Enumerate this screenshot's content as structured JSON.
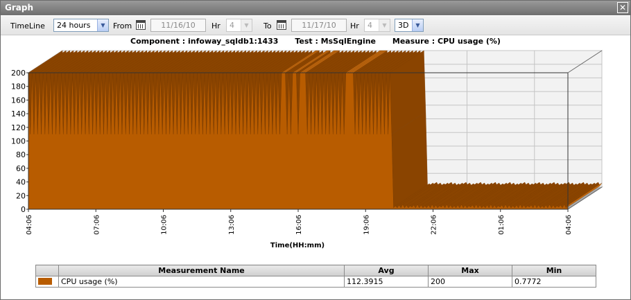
{
  "window": {
    "title": "Graph",
    "close_label": "✕"
  },
  "toolbar": {
    "timeline_label": "TimeLine",
    "timeline_value": "24 hours",
    "from_label": "From",
    "from_date": "11/16/10",
    "from_hr_label": "Hr",
    "from_hr_value": "4",
    "to_label": "To",
    "to_date": "11/17/10",
    "to_hr_label": "Hr",
    "to_hr_value": "4",
    "view_mode": "3D"
  },
  "header": {
    "component": "Component : infoway_sqldb1:1433",
    "test": "Test : MsSqlEngine",
    "measure": "Measure : CPU usage  (%)"
  },
  "chart_data": {
    "type": "area",
    "title": "",
    "xlabel": "Time(HH:mm)",
    "ylabel": "",
    "ylim": [
      0,
      200
    ],
    "yticks": [
      "0",
      "20",
      "40",
      "60",
      "80",
      "100",
      "120",
      "140",
      "160",
      "180",
      "200"
    ],
    "xticks": [
      "04:06",
      "07:06",
      "10:06",
      "13:06",
      "16:06",
      "19:06",
      "22:06",
      "01:06",
      "04:06"
    ],
    "series": [
      {
        "name": "CPU usage (%)",
        "color": "#b85c00",
        "values": [
          200,
          110,
          200,
          110,
          200,
          110,
          200,
          110,
          200,
          110,
          200,
          110,
          200,
          110,
          200,
          110,
          200,
          110,
          200,
          110,
          200,
          110,
          200,
          110,
          200,
          110,
          200,
          110,
          200,
          110,
          200,
          110,
          200,
          110,
          200,
          110,
          200,
          110,
          200,
          110,
          200,
          110,
          200,
          110,
          200,
          110,
          200,
          110,
          200,
          110,
          200,
          110,
          200,
          110,
          200,
          110,
          200,
          110,
          200,
          110,
          200,
          110,
          200,
          110,
          200,
          110,
          200,
          110,
          200,
          110,
          200,
          110,
          200,
          110,
          200,
          110,
          200,
          110,
          200,
          110,
          200,
          110,
          200,
          110,
          200,
          110,
          200,
          110,
          200,
          110,
          200,
          110,
          200,
          110,
          200,
          110,
          200,
          110,
          200,
          110,
          200,
          110,
          200,
          110,
          200,
          110,
          200,
          110,
          200,
          110,
          200,
          110,
          200,
          110,
          200,
          110,
          200,
          110,
          200,
          110,
          200,
          110,
          200,
          110,
          200,
          110,
          200,
          110,
          200,
          110,
          200,
          110,
          200,
          110,
          200,
          110,
          200,
          110,
          200,
          200,
          200,
          110,
          200,
          110,
          200,
          200,
          200,
          110,
          200,
          200,
          200,
          200,
          110,
          200,
          110,
          200,
          110,
          200,
          110,
          200,
          110,
          200,
          110,
          200,
          110,
          200,
          110,
          200,
          110,
          200,
          110,
          200,
          110,
          200,
          200,
          200,
          200,
          200,
          110,
          200,
          110,
          200,
          110,
          200,
          110,
          200,
          110,
          200,
          110,
          200,
          110,
          200,
          110,
          200,
          110,
          200,
          110,
          200,
          110,
          2,
          5,
          2,
          6,
          2,
          7,
          2,
          6,
          2,
          5,
          3,
          6,
          2,
          7,
          2,
          6,
          2,
          5,
          2,
          6,
          2,
          7,
          2,
          6,
          2,
          5,
          3,
          6,
          2,
          7,
          2,
          6,
          2,
          5,
          2,
          6,
          2,
          7,
          2,
          6,
          2,
          5,
          3,
          6,
          2,
          7,
          2,
          6,
          2,
          5,
          2,
          6,
          2,
          7,
          2,
          6,
          2,
          5,
          3,
          6,
          2,
          7,
          2,
          6,
          2,
          5,
          2,
          6,
          2,
          7,
          2,
          6,
          2,
          5,
          3,
          6,
          2,
          7,
          2,
          6,
          2,
          5,
          2,
          6,
          2,
          7,
          2,
          6,
          2,
          5,
          3,
          6,
          2,
          7,
          2,
          6
        ]
      }
    ],
    "grid": true,
    "legend": "none"
  },
  "table": {
    "columns": [
      "",
      "Measurement Name",
      "Avg",
      "Max",
      "Min"
    ],
    "rows": [
      {
        "color": "#b85c00",
        "name": "CPU usage (%)",
        "avg": "112.3915",
        "max": "200",
        "min": "0.7772"
      }
    ]
  }
}
